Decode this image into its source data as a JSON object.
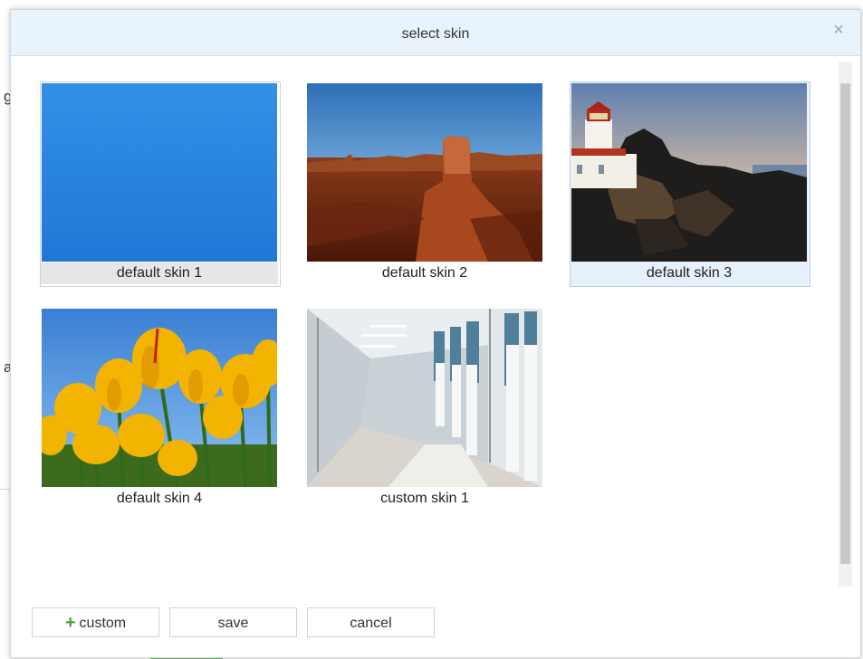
{
  "background": {
    "fragment_top": "g",
    "fragment_mid": "a"
  },
  "dialog": {
    "title": "select skin",
    "close_glyph": "×"
  },
  "skins": [
    {
      "label": "default skin 1"
    },
    {
      "label": "default skin 2"
    },
    {
      "label": "default skin 3"
    },
    {
      "label": "default skin 4"
    },
    {
      "label": "custom skin 1"
    }
  ],
  "footer": {
    "custom_label": "custom",
    "custom_icon": "plus-icon",
    "save_label": "save",
    "cancel_label": "cancel"
  },
  "colors": {
    "header_bg": "#e8f3fb",
    "selected_tile_bg": "#eaf3fc",
    "plus_icon": "#4aa03a"
  }
}
